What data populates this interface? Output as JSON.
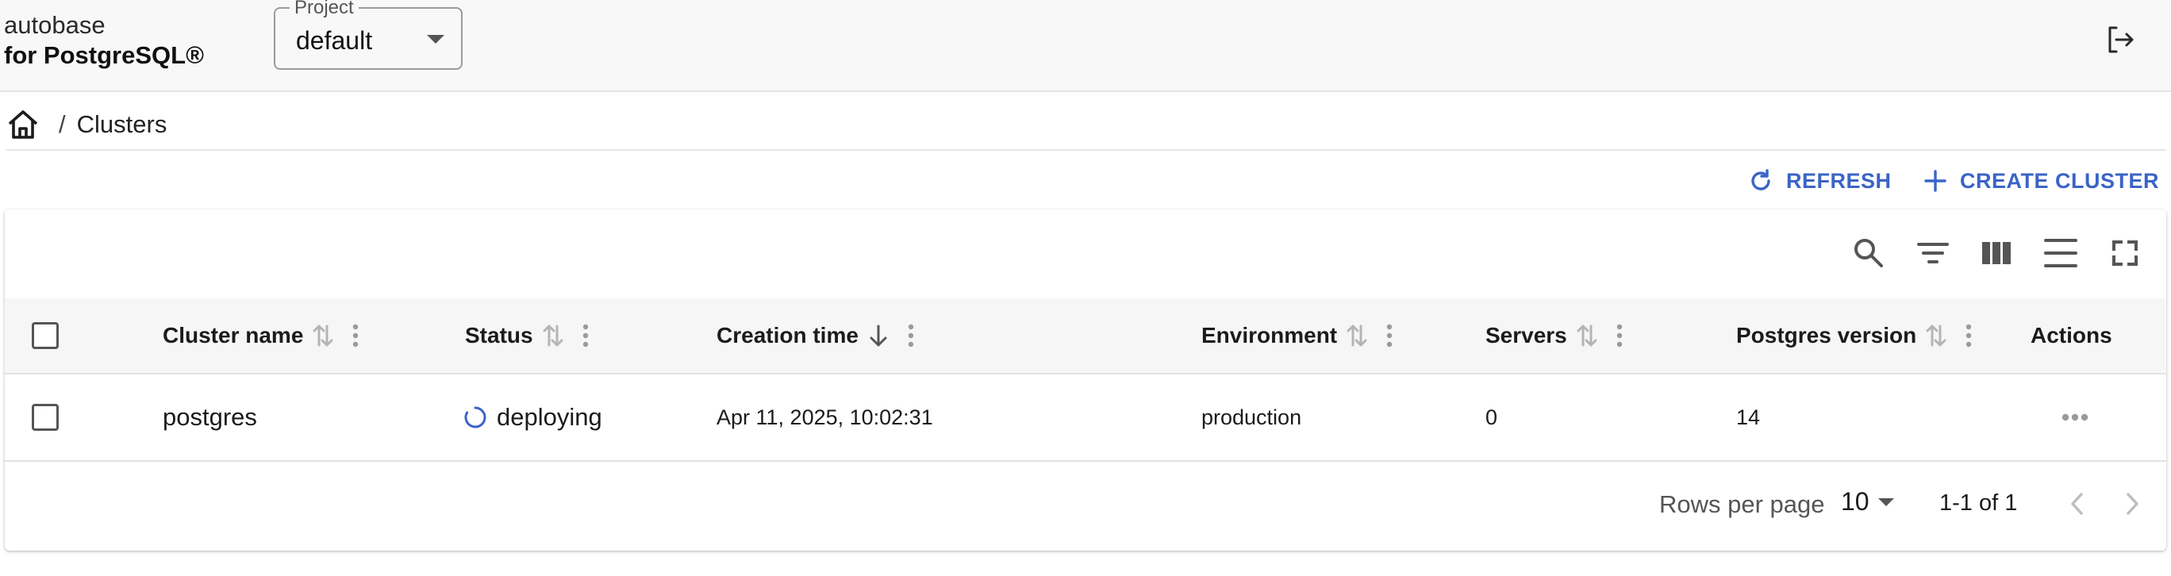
{
  "header": {
    "brand_line1": "autobase",
    "brand_line2": "for PostgreSQL®",
    "project_label": "Project",
    "project_value": "default"
  },
  "breadcrumb": {
    "separator": "/",
    "current": "Clusters"
  },
  "actions": {
    "refresh_label": "REFRESH",
    "create_label": "CREATE CLUSTER"
  },
  "table": {
    "columns": {
      "cluster_name": "Cluster name",
      "status": "Status",
      "creation_time": "Creation time",
      "environment": "Environment",
      "servers": "Servers",
      "postgres_version": "Postgres version",
      "actions": "Actions"
    },
    "rows": [
      {
        "cluster_name": "postgres",
        "status": "deploying",
        "creation_time": "Apr 11, 2025, 10:02:31",
        "environment": "production",
        "servers": "0",
        "postgres_version": "14"
      }
    ],
    "footer": {
      "rows_per_page_label": "Rows per page",
      "rows_per_page_value": "10",
      "range": "1-1 of 1"
    }
  },
  "icons": {
    "header": [
      "chevron-down-icon",
      "logout-icon"
    ],
    "breadcrumb": [
      "home-icon"
    ],
    "actions": [
      "refresh-icon",
      "plus-icon"
    ],
    "toolbar": [
      "search-icon",
      "filter-icon",
      "columns-icon",
      "density-icon",
      "fullscreen-icon"
    ],
    "table": [
      "sort-icon",
      "column-menu-icon",
      "sort-descending-icon",
      "spinner-icon",
      "more-horizontal-icon"
    ],
    "pagination": [
      "chevron-left-icon",
      "chevron-right-icon"
    ]
  },
  "colors": {
    "accent": "#3a64c7",
    "header_bg": "#f8f8f9",
    "table_header_bg": "#f6f6f7"
  }
}
